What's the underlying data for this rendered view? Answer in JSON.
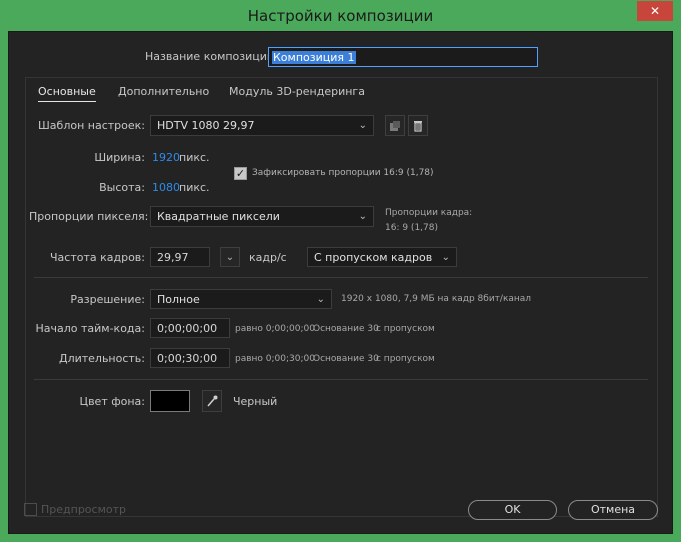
{
  "window": {
    "title": "Настройки композиции",
    "close_glyph": "✕"
  },
  "composition_name": {
    "label": "Название композиции:",
    "value": "Композиция 1"
  },
  "tabs": [
    {
      "label": "Основные",
      "active": true
    },
    {
      "label": "Дополнительно",
      "active": false
    },
    {
      "label": "Модуль 3D-рендеринга",
      "active": false
    }
  ],
  "preset": {
    "label": "Шаблон настроек:",
    "value": "HDTV 1080 29,97",
    "copy_icon": "copy-preset-icon",
    "delete_icon": "trash-icon"
  },
  "width": {
    "label": "Ширина:",
    "value": "1920",
    "unit": "пикс."
  },
  "height": {
    "label": "Высота:",
    "value": "1080",
    "unit": "пикс."
  },
  "lock_aspect": {
    "label": "Зафиксировать пропорции 16:9 (1,78)",
    "checked": true
  },
  "pixel_aspect": {
    "label": "Пропорции пикселя:",
    "value": "Квадратные пиксели",
    "frame_aspect_label": "Пропорции кадра:",
    "frame_aspect_value": "16: 9 (1,78)"
  },
  "frame_rate": {
    "label": "Частота кадров:",
    "value": "29,97",
    "unit": "кадр/с",
    "drop_frame": "С пропуском кадров"
  },
  "resolution": {
    "label": "Разрешение:",
    "value": "Полное",
    "info": "1920 х 1080, 7,9 МБ на кадр 8бит/канал"
  },
  "start_timecode": {
    "label": "Начало тайм-кода:",
    "value": "0;00;00;00",
    "equals": "равно 0;00;00;00",
    "base": "Основание 30",
    "drop": "с пропуском"
  },
  "duration": {
    "label": "Длительность:",
    "value": "0;00;30;00",
    "equals": "равно 0;00;30;00",
    "base": "Основание 30",
    "drop": "с пропуском"
  },
  "background": {
    "label": "Цвет фона:",
    "color": "#000000",
    "color_name": "Черный",
    "eyedropper_icon": "eyedropper-icon"
  },
  "footer": {
    "preview_label": "Предпросмотр",
    "preview_checked": false,
    "ok_label": "OK",
    "cancel_label": "Отмена"
  },
  "colors": {
    "title_bar": "#4aa95a",
    "close_button": "#c7453a",
    "dialog_bg": "#232323",
    "accent_value": "#2d8ceb"
  }
}
